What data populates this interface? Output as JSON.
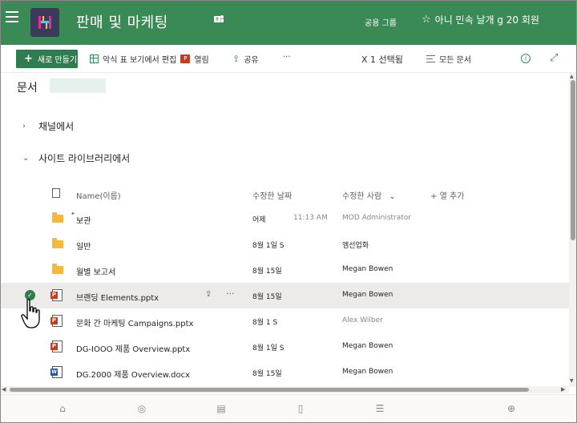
{
  "header": {
    "site_title": "판매 및 마케팅",
    "group_label": "공용 그룹",
    "member_text": "아니 민속 날개 g 20 회원"
  },
  "toolbar": {
    "new_label": "새로 만들기",
    "grid_edit_label": "악식 표 보기에서 편집",
    "open_label": "열림",
    "share_label": "공유",
    "more_label": "···",
    "selected_label": "X 1 선택됨",
    "all_docs_label": "모든 문서"
  },
  "page": {
    "title": "문서"
  },
  "sections": {
    "channels": "채널에서",
    "site_library": "사이트 라이브러리에서"
  },
  "columns": {
    "name": "Name(이름)",
    "modified": "수정한 날짜",
    "modified_by": "수정한 사람",
    "add_column": "열 추가"
  },
  "rows": [
    {
      "type": "folder",
      "name": "보관",
      "date": "어제",
      "time": "11:13 AM",
      "who": "MOD Administrator",
      "who_gray": true,
      "selected": false
    },
    {
      "type": "folder",
      "name": "일반",
      "date": "8월 1일 S",
      "time": "",
      "who": "엠선업화",
      "who_gray": false,
      "selected": false
    },
    {
      "type": "folder",
      "name": "월별 보고서",
      "date": "8월 15일",
      "time": "",
      "who": "Megan Bowen",
      "who_gray": false,
      "selected": false
    },
    {
      "type": "ppt",
      "name": "브랜딩 Elements.pptx",
      "date": "8월 15일",
      "time": "",
      "who": "Megan Bowen",
      "who_gray": false,
      "selected": true
    },
    {
      "type": "ppt",
      "name": "문화 간 마케팅 Campaigns.pptx",
      "date": "8월 1 S",
      "time": "",
      "who": "Alex Wilber",
      "who_gray": true,
      "selected": false
    },
    {
      "type": "ppt",
      "name": "DG-IOOO 제품 Overview.pptx",
      "date": "8월 1일 S",
      "time": "",
      "who": "Megan  Bowen",
      "who_gray": false,
      "selected": false
    },
    {
      "type": "docx",
      "name": "DG.2000 제품 Overview.docx",
      "date": "8월 15일",
      "time": "",
      "who": "Megan Bowen",
      "who_gray": false,
      "selected": false
    }
  ],
  "icons": {
    "accent": "#3a8a55",
    "header_bg": "#3a8a55",
    "folder_color": "#f6b73c",
    "ppt_color": "#c43e1c",
    "word_color": "#2b579a"
  }
}
